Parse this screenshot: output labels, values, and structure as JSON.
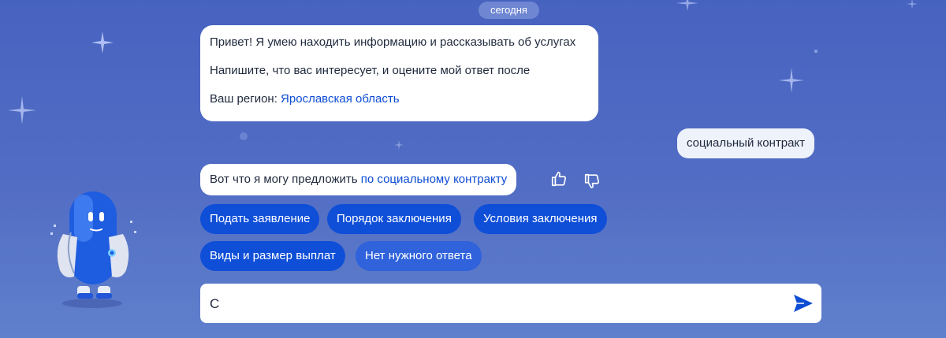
{
  "chat": {
    "date_label": "сегодня",
    "greeting": {
      "line1": "Привет! Я умею находить информацию и рассказывать об услугах",
      "line2": "Напишите, что вас интересует, и оцените мой ответ после",
      "region_prefix": "Ваш регион: ",
      "region_link": "Ярославская область"
    },
    "user_message": "социальный контракт",
    "bot_offer": {
      "prefix": "Вот что я могу предложить ",
      "link": "по социальному контракту"
    },
    "quick_replies": [
      "Подать заявление",
      "Порядок заключения",
      "Условия заключения",
      "Виды и размер выплат",
      "Нет нужного ответа"
    ],
    "input": {
      "value": "С"
    },
    "icons": {
      "like": "thumbs-up-icon",
      "dislike": "thumbs-down-icon",
      "send": "send-arrow-icon",
      "assistant": "robot-assistant-icon"
    },
    "colors": {
      "accent": "#0d4cd3",
      "chip": "#0f4fd8",
      "background": "#4763c0"
    }
  }
}
